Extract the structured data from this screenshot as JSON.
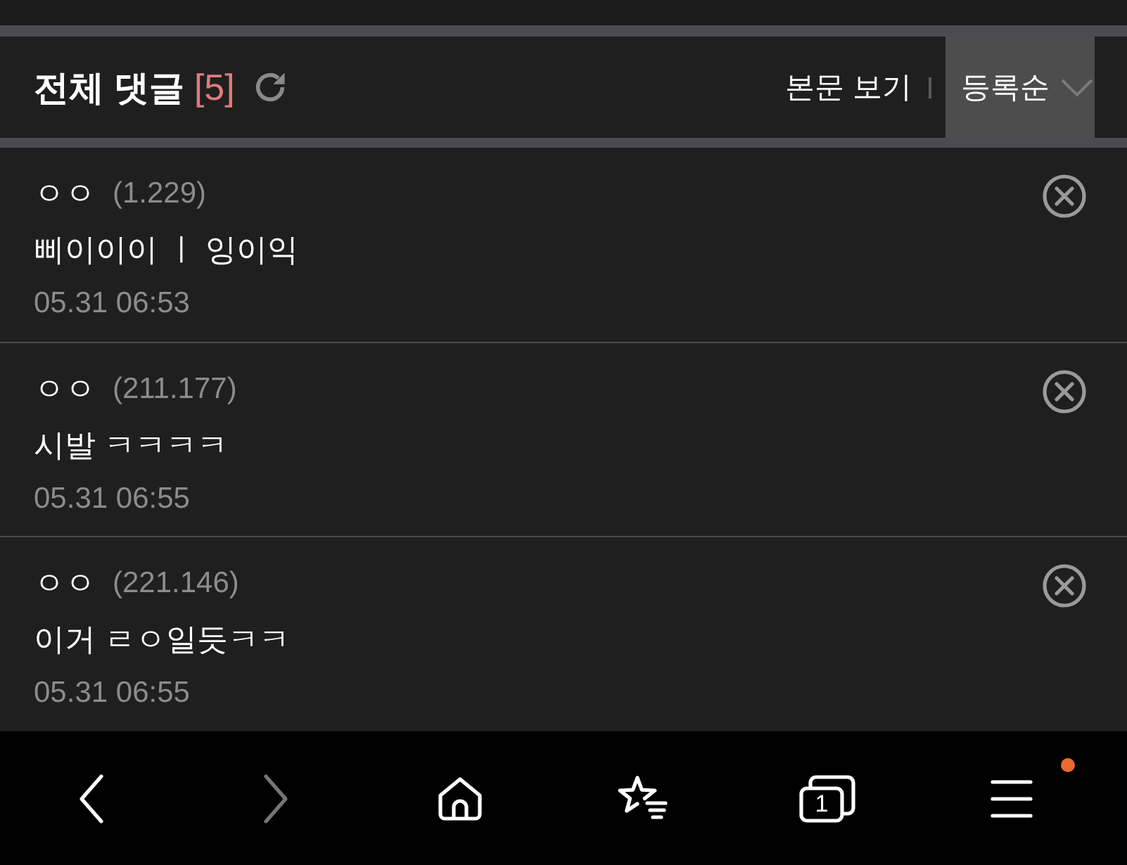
{
  "header": {
    "title": "전체 댓글",
    "count": "[5]",
    "view_article": "본문 보기",
    "sort": "등록순"
  },
  "comments": [
    {
      "author": "ㅇㅇ",
      "ip": "(1.229)",
      "text": "삐이이이 ㅣ 잉이익",
      "time": "05.31 06:53"
    },
    {
      "author": "ㅇㅇ",
      "ip": "(211.177)",
      "text": "시발 ㅋㅋㅋㅋ",
      "time": "05.31 06:55"
    },
    {
      "author": "ㅇㅇ",
      "ip": "(221.146)",
      "text": "이거 ㄹㅇ일듯ㅋㅋ",
      "time": "05.31 06:55"
    }
  ],
  "nav": {
    "items": [
      {
        "kind": "back",
        "disabled": false,
        "badge": false
      },
      {
        "kind": "forward",
        "disabled": true,
        "badge": false
      },
      {
        "kind": "home",
        "disabled": false,
        "badge": false
      },
      {
        "kind": "bookmarks",
        "disabled": false,
        "badge": false
      },
      {
        "kind": "tabs",
        "disabled": false,
        "badge": false,
        "count": "1"
      },
      {
        "kind": "menu",
        "disabled": false,
        "badge": true
      }
    ]
  }
}
